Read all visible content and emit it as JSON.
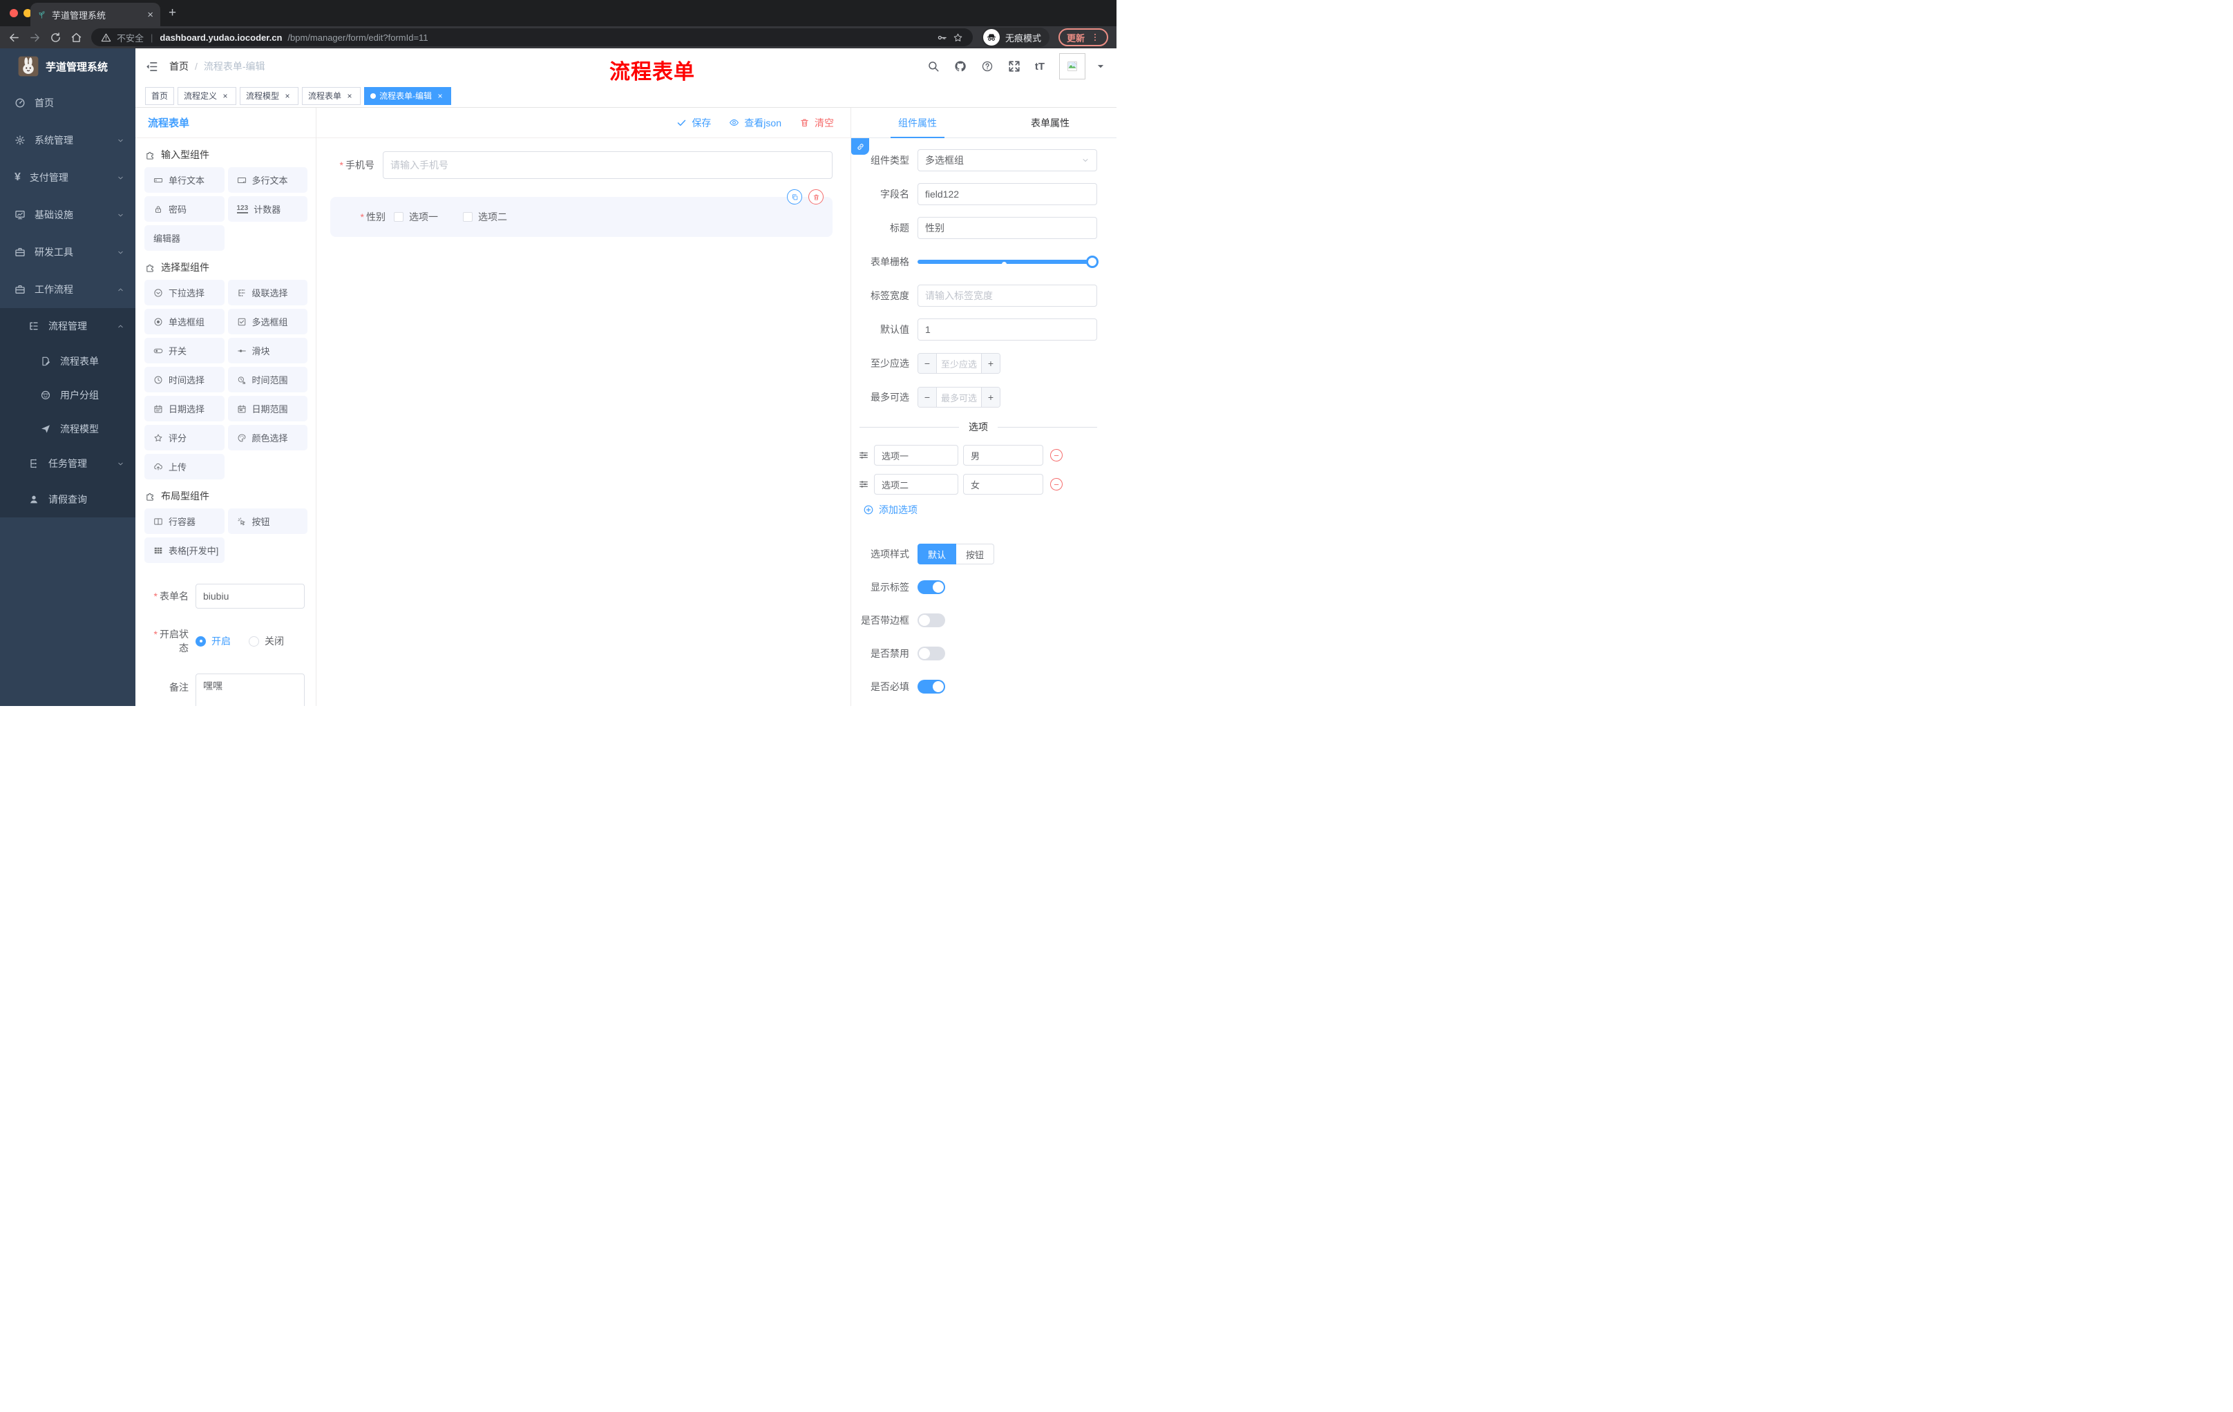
{
  "colors": {
    "accent": "#409eff",
    "danger": "#f56c6c",
    "sidebar_bg": "#304156",
    "submenu_bg": "#263445",
    "annotation_red": "#fe0000",
    "palette_card_bg": "#f4f6fd"
  },
  "browser": {
    "tab_title": "芋道管理系统",
    "close_glyph": "×",
    "new_tab_glyph": "+",
    "security_label": "不安全",
    "url_host": "dashboard.yudao.iocoder.cn",
    "url_path": "/bpm/manager/form/edit?formId=11",
    "incognito_label": "无痕模式",
    "update_label": "更新"
  },
  "sidebar": {
    "logo_title": "芋道管理系统",
    "menu": [
      {
        "label": "首页",
        "icon": "dashboard",
        "level": 1,
        "arrow": "",
        "dark": false
      },
      {
        "label": "系统管理",
        "icon": "gear",
        "level": 1,
        "arrow": "down",
        "dark": false
      },
      {
        "label": "支付管理",
        "icon": "yen",
        "level": 1,
        "arrow": "down",
        "dark": false
      },
      {
        "label": "基础设施",
        "icon": "monitor",
        "level": 1,
        "arrow": "down",
        "dark": false
      },
      {
        "label": "研发工具",
        "icon": "toolbox",
        "level": 1,
        "arrow": "down",
        "dark": false
      },
      {
        "label": "工作流程",
        "icon": "toolbox",
        "level": 1,
        "arrow": "up",
        "dark": false
      },
      {
        "label": "流程管理",
        "icon": "list-tree",
        "level": 2,
        "arrow": "up",
        "dark": true
      },
      {
        "label": "流程表单",
        "icon": "doc-edit",
        "level": 3,
        "arrow": "",
        "dark": true
      },
      {
        "label": "用户分组",
        "icon": "face",
        "level": 3,
        "arrow": "",
        "dark": true
      },
      {
        "label": "流程模型",
        "icon": "send",
        "level": 3,
        "arrow": "",
        "dark": true
      },
      {
        "label": "任务管理",
        "icon": "org-tree",
        "level": 2,
        "arrow": "down",
        "dark": true
      },
      {
        "label": "请假查询",
        "icon": "user",
        "level": 2,
        "arrow": "",
        "dark": true
      }
    ]
  },
  "header": {
    "breadcrumb": [
      "首页",
      "流程表单-编辑"
    ],
    "breadcrumb_sep": "/",
    "annotation": "流程表单",
    "icons": [
      "search",
      "github",
      "help",
      "expand",
      "font-size"
    ],
    "font_size_glyph": "tT"
  },
  "tags": [
    {
      "label": "首页",
      "closable": false,
      "active": false
    },
    {
      "label": "流程定义",
      "closable": true,
      "active": false
    },
    {
      "label": "流程模型",
      "closable": true,
      "active": false
    },
    {
      "label": "流程表单",
      "closable": true,
      "active": false
    },
    {
      "label": "流程表单-编辑",
      "closable": true,
      "active": true
    }
  ],
  "palette": {
    "title": "流程表单",
    "sections": [
      {
        "title": "输入型组件",
        "icon": "puzzle",
        "items": [
          {
            "label": "单行文本",
            "icon": "input-box"
          },
          {
            "label": "多行文本",
            "icon": "textarea-box"
          },
          {
            "label": "密码",
            "icon": "lock"
          },
          {
            "label": "计数器",
            "icon": "num123"
          },
          {
            "label": "编辑器",
            "icon": ""
          }
        ]
      },
      {
        "title": "选择型组件",
        "icon": "puzzle",
        "items": [
          {
            "label": "下拉选择",
            "icon": "select-down"
          },
          {
            "label": "级联选择",
            "icon": "cascade"
          },
          {
            "label": "单选框组",
            "icon": "radio"
          },
          {
            "label": "多选框组",
            "icon": "checkbox"
          },
          {
            "label": "开关",
            "icon": "switch"
          },
          {
            "label": "滑块",
            "icon": "slider-h"
          },
          {
            "label": "时间选择",
            "icon": "clock"
          },
          {
            "label": "时间范围",
            "icon": "clock-range"
          },
          {
            "label": "日期选择",
            "icon": "calendar"
          },
          {
            "label": "日期范围",
            "icon": "calendar-range"
          },
          {
            "label": "评分",
            "icon": "star"
          },
          {
            "label": "颜色选择",
            "icon": "palette"
          },
          {
            "label": "上传",
            "icon": "cloud-up"
          }
        ]
      },
      {
        "title": "布局型组件",
        "icon": "puzzle",
        "items": [
          {
            "label": "行容器",
            "icon": "columns"
          },
          {
            "label": "按钮",
            "icon": "click"
          },
          {
            "label": "表格[开发中]",
            "icon": "table-grid"
          }
        ]
      }
    ],
    "form": {
      "name_label": "表单名",
      "name_value": "biubiu",
      "status_label": "开启状态",
      "status_options": [
        {
          "label": "开启",
          "selected": true
        },
        {
          "label": "关闭",
          "selected": false
        }
      ],
      "remark_label": "备注",
      "remark_value": "嘿嘿"
    }
  },
  "canvas": {
    "toolbar": {
      "save": "保存",
      "view_json": "查看json",
      "clear": "清空"
    },
    "phone": {
      "label": "手机号",
      "placeholder": "请输入手机号"
    },
    "gender": {
      "label": "性别",
      "options": [
        "选项一",
        "选项二"
      ]
    }
  },
  "props": {
    "tabs": [
      {
        "label": "组件属性",
        "active": true
      },
      {
        "label": "表单属性",
        "active": false
      }
    ],
    "rows": {
      "type_label": "组件类型",
      "type_value": "多选框组",
      "field_label": "字段名",
      "field_value": "field122",
      "title_label": "标题",
      "title_value": "性别",
      "grid_label": "表单栅格",
      "grid_percent": 100,
      "grid_marker_percent": 47,
      "width_label": "标签宽度",
      "width_placeholder": "请输入标签宽度",
      "default_label": "默认值",
      "default_value": "1",
      "min_label": "至少应选",
      "min_placeholder": "至少应选",
      "max_label": "最多可选",
      "max_placeholder": "最多可选"
    },
    "options_divider": "选项",
    "options": [
      {
        "label": "选项一",
        "value": "男"
      },
      {
        "label": "选项二",
        "value": "女"
      }
    ],
    "add_option": "添加选项",
    "style_label": "选项样式",
    "style_options": [
      {
        "label": "默认",
        "active": true
      },
      {
        "label": "按钮",
        "active": false
      }
    ],
    "toggles": [
      {
        "label": "显示标签",
        "on": true
      },
      {
        "label": "是否带边框",
        "on": false
      },
      {
        "label": "是否禁用",
        "on": false
      },
      {
        "label": "是否必填",
        "on": true
      }
    ]
  }
}
